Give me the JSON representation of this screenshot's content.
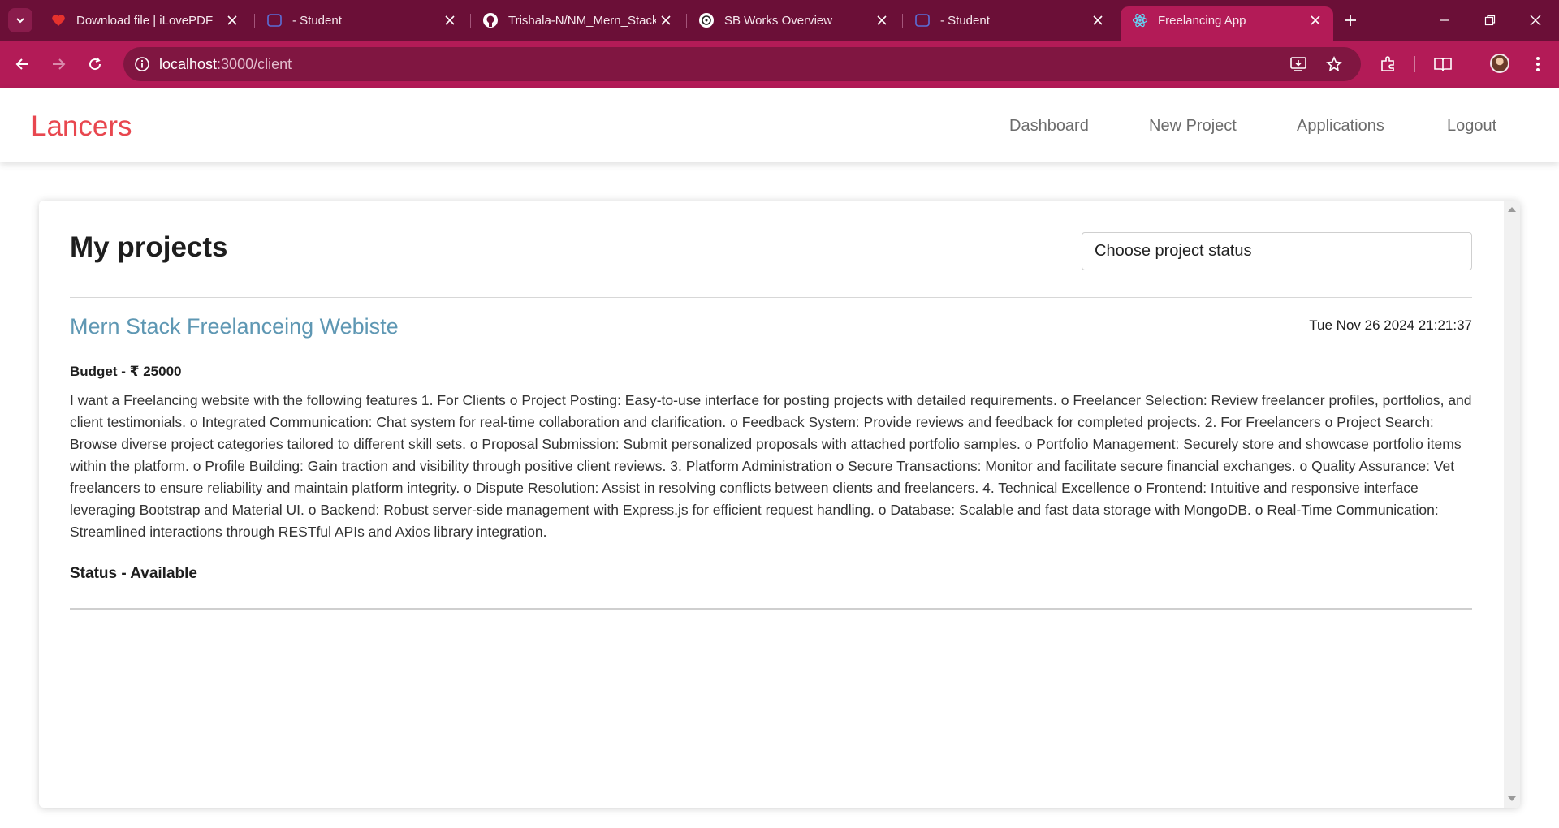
{
  "browser": {
    "tabs": [
      {
        "label": "Download file | iLovePDF",
        "favicon": "heart-icon"
      },
      {
        "label": "- Student",
        "favicon": "tab-page-icon"
      },
      {
        "label": "Trishala-N/NM_Mern_Stack",
        "favicon": "github-icon"
      },
      {
        "label": "SB Works Overview",
        "favicon": "openai-icon"
      },
      {
        "label": "- Student",
        "favicon": "tab-page-icon"
      },
      {
        "label": "Freelancing App",
        "favicon": "react-icon"
      }
    ],
    "url_host": "localhost",
    "url_path": ":3000/client",
    "colors": {
      "tabstrip": "#6b0f37",
      "toolbar": "#b31b57",
      "omnibox": "#801641"
    }
  },
  "navbar": {
    "brand": "Lancers",
    "links": [
      "Dashboard",
      "New Project",
      "Applications",
      "Logout"
    ],
    "brand_color": "#e8474f"
  },
  "page": {
    "title": "My projects",
    "status_select": "Choose project status",
    "project": {
      "title": "Mern Stack Freelanceing Webiste",
      "date": "Tue Nov 26 2024 21:21:37",
      "budget": "Budget - ₹ 25000",
      "description": "I want a Freelancing website with the following features 1. For Clients o Project Posting: Easy-to-use interface for posting projects with detailed requirements. o Freelancer Selection: Review freelancer profiles, portfolios, and client testimonials. o Integrated Communication: Chat system for real-time collaboration and clarification. o Feedback System: Provide reviews and feedback for completed projects. 2. For Freelancers o Project Search: Browse diverse project categories tailored to different skill sets. o Proposal Submission: Submit personalized proposals with attached portfolio samples. o Portfolio Management: Securely store and showcase portfolio items within the platform. o Profile Building: Gain traction and visibility through positive client reviews. 3. Platform Administration o Secure Transactions: Monitor and facilitate secure financial exchanges. o Quality Assurance: Vet freelancers to ensure reliability and maintain platform integrity. o Dispute Resolution: Assist in resolving conflicts between clients and freelancers. 4. Technical Excellence o Frontend: Intuitive and responsive interface leveraging Bootstrap and Material UI. o Backend: Robust server-side management with Express.js for efficient request handling. o Database: Scalable and fast data storage with MongoDB. o Real-Time Communication: Streamlined interactions through RESTful APIs and Axios library integration.",
      "status": "Status - Available",
      "title_color": "#5e97b3"
    }
  }
}
